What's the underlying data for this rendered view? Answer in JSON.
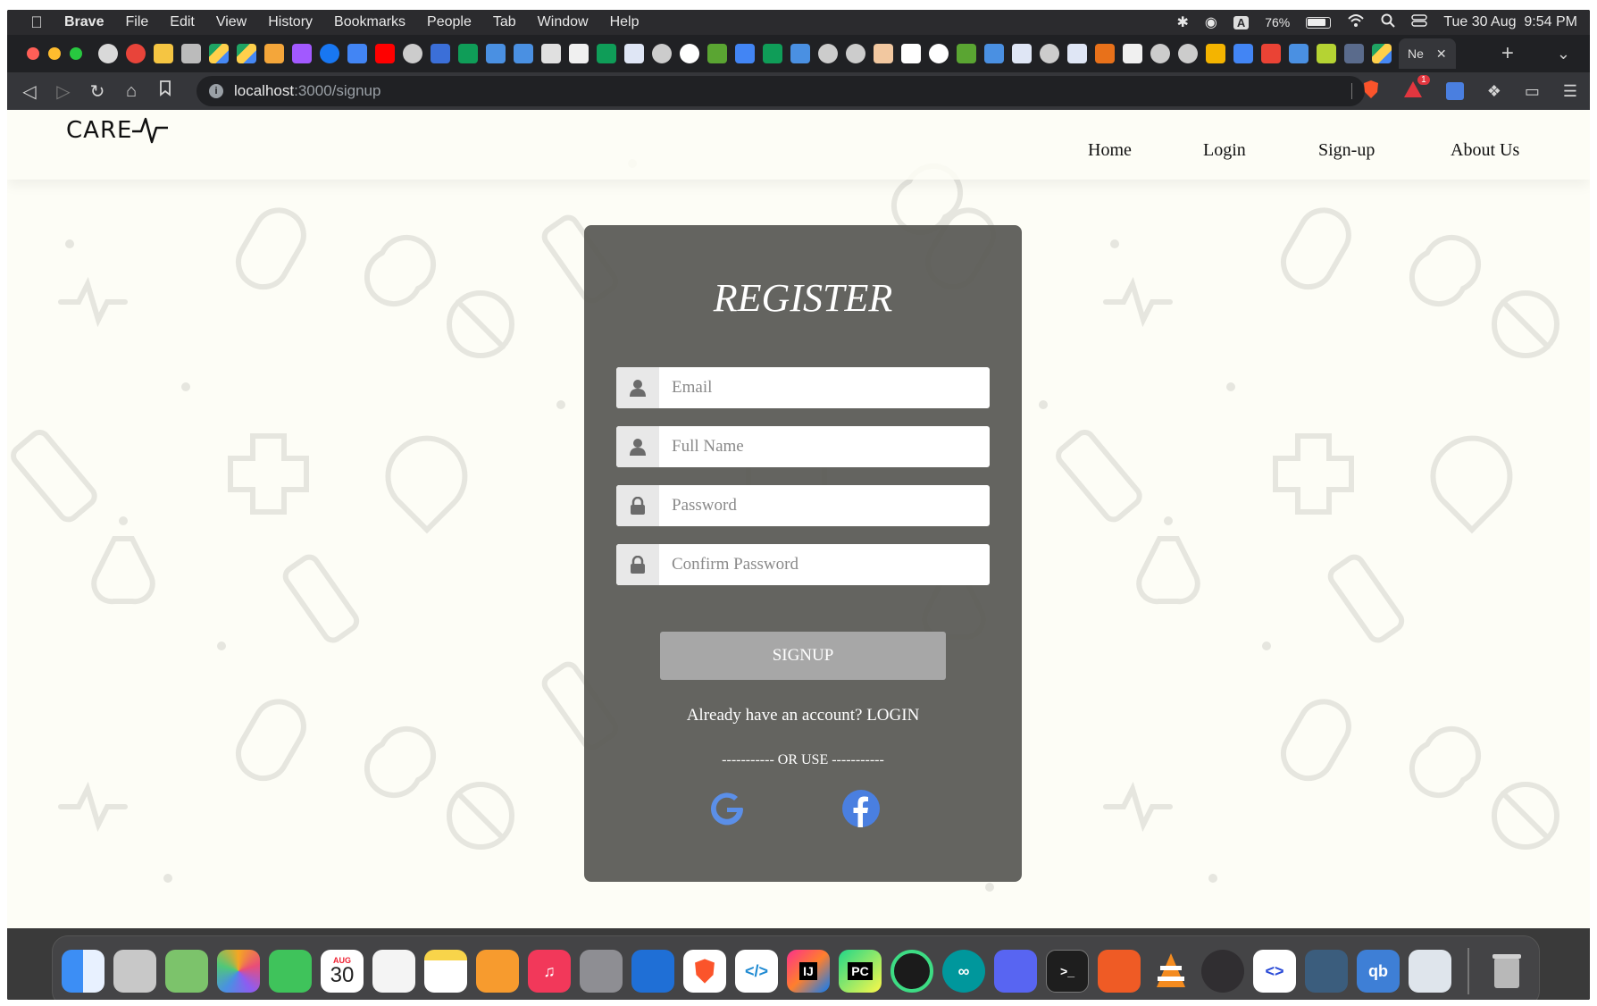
{
  "menubar": {
    "app": "Brave",
    "items": [
      "File",
      "Edit",
      "View",
      "History",
      "Bookmarks",
      "People",
      "Tab",
      "Window",
      "Help"
    ],
    "battery": "76%",
    "battery_level": 0.76,
    "datetime": "Tue 30 Aug  9:54 PM",
    "keyboard_indicator": "A"
  },
  "tab": {
    "title": "Ne",
    "close": "✕",
    "new_tab": "+",
    "tab_menu": "⌄"
  },
  "address": {
    "host": "localhost",
    "path": ":3000/signup"
  },
  "brave": {
    "alerts_badge": "1"
  },
  "site": {
    "logo": "CARE",
    "nav": [
      "Home",
      "Login",
      "Sign-up",
      "About Us"
    ]
  },
  "register": {
    "title": "REGISTER",
    "email_placeholder": "Email",
    "fullname_placeholder": "Full Name",
    "password_placeholder": "Password",
    "confirm_placeholder": "Confirm Password",
    "signup_label": "SIGNUP",
    "already_text": "Already have an account? LOGIN",
    "or_use": "----------- OR USE -----------"
  },
  "dock": {
    "calendar_month": "AUG",
    "calendar_day": "30",
    "intellij": "IJ",
    "pycharm": "PC",
    "qbittorrent": "qb"
  },
  "colors": {
    "page_bg": "#fdfdf6",
    "card_bg": "#585854",
    "button_bg": "#a7a7a7",
    "google_blue": "#5b8fe8",
    "facebook_blue": "#4a7fe0"
  },
  "icons": {
    "google": "google-icon",
    "facebook": "facebook-icon",
    "user": "user-icon",
    "lock": "lock-icon"
  }
}
